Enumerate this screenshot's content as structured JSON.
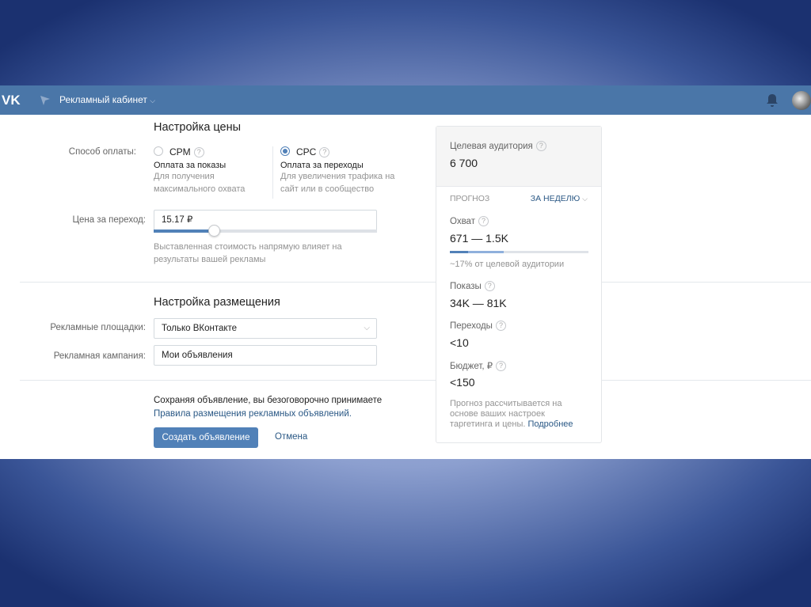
{
  "header": {
    "title": "Рекламный кабинет"
  },
  "price": {
    "heading": "Настройка цены",
    "payment_label": "Способ оплаты:",
    "options": [
      {
        "name": "CPM",
        "title": "Оплата за показы",
        "desc1": "Для получения",
        "desc2": "максимального охвата",
        "selected": false
      },
      {
        "name": "CPC",
        "title": "Оплата за переходы",
        "desc1": "Для увеличения трафика на",
        "desc2": "сайт или в сообщество",
        "selected": true
      }
    ],
    "price_label": "Цена за переход:",
    "price_value": "15.17",
    "currency": "₽",
    "slider_fraction": 0.27,
    "hint1": "Выставленная стоимость напрямую влияет на",
    "hint2": "результаты вашей рекламы"
  },
  "placement": {
    "heading": "Настройка размещения",
    "platforms_label": "Рекламные площадки:",
    "platforms_value": "Только ВКонтакте",
    "campaign_label": "Рекламная кампания:",
    "campaign_value": "Мои объявления"
  },
  "footer": {
    "agree": "Сохраняя объявление, вы безоговорочно принимаете",
    "rules_link": "Правила размещения рекламных объявлений.",
    "create_button": "Создать объявление",
    "cancel_button": "Отмена"
  },
  "forecast": {
    "audience_label": "Целевая аудитория",
    "audience_value": "6 700",
    "title": "ПРОГНОЗ",
    "period": "ЗА НЕДЕЛЮ",
    "reach_label": "Охват",
    "reach_value": "671 — 1.5K",
    "reach_fraction": 0.17,
    "reach_note": "~17% от целевой аудитории",
    "impressions_label": "Показы",
    "impressions_value": "34K — 81K",
    "clicks_label": "Переходы",
    "clicks_value": "<10",
    "budget_label": "Бюджет,",
    "budget_currency": "₽",
    "budget_value": "<150",
    "note1": "Прогноз рассчитывается на",
    "note2": "основе ваших настроек",
    "note3": "таргетинга и цены.",
    "more_link": "Подробнее"
  },
  "colors": {
    "header": "#4a76a8",
    "accent": "#5181b8",
    "link": "#2a5885"
  }
}
